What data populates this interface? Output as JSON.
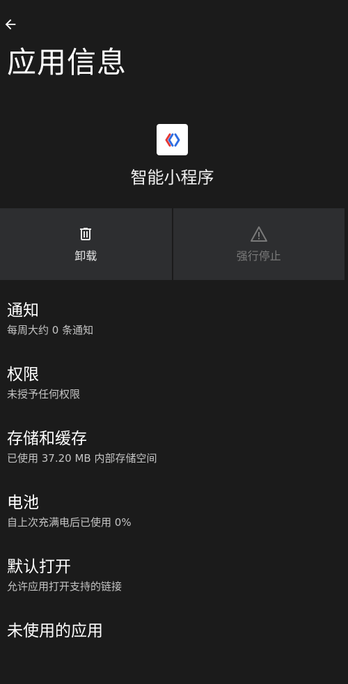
{
  "header": {
    "back_icon": "arrow-back-icon",
    "title": "应用信息"
  },
  "app": {
    "name": "智能小程序",
    "icon": "smart-mini-program-icon"
  },
  "actions": [
    {
      "label": "卸载",
      "icon": "trash-icon",
      "enabled": true
    },
    {
      "label": "强行停止",
      "icon": "warning-icon",
      "enabled": false
    }
  ],
  "items": [
    {
      "title": "通知",
      "summary": "每周大约 0 条通知"
    },
    {
      "title": "权限",
      "summary": "未授予任何权限"
    },
    {
      "title": "存储和缓存",
      "summary": "已使用 37.20 MB 内部存储空间"
    },
    {
      "title": "电池",
      "summary": "自上次充满电后已使用 0%"
    },
    {
      "title": "默认打开",
      "summary": "允许应用打开支持的链接"
    },
    {
      "title": "未使用的应用",
      "summary": ""
    }
  ],
  "colors": {
    "background": "#1b1b1b",
    "button_bg": "#2d2e30",
    "text_primary": "#ffffff",
    "text_secondary": "#c4c4c4",
    "text_disabled": "#7a7a7a",
    "icon_blue": "#2f6de1",
    "icon_red": "#e53935"
  }
}
